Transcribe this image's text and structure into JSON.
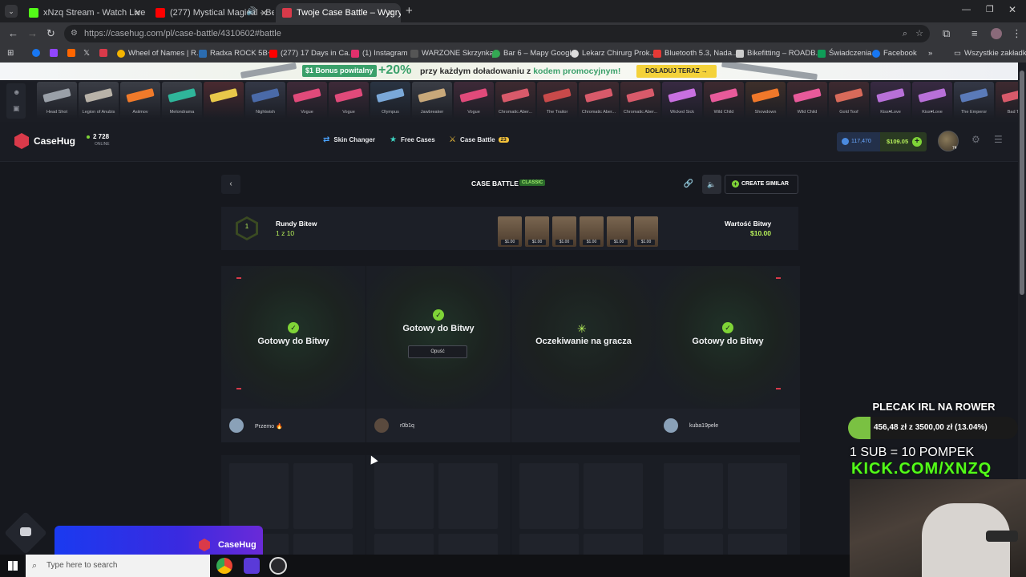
{
  "browser": {
    "tabs": [
      {
        "title": "xNzq Stream - Watch Live on K",
        "color": "#53fc18"
      },
      {
        "title": "(277) Mystical Magical - Be",
        "color": "#ff0000"
      },
      {
        "title": "Twoje Case Battle – Wygrywaj s",
        "color": "#d93a4a"
      }
    ],
    "url": "https://casehug.com/pl/case-battle/4310602#battle",
    "bookmarks": [
      {
        "label": "",
        "color": "#1877f2"
      },
      {
        "label": "",
        "color": "#9146ff"
      },
      {
        "label": "",
        "color": "#ff6600"
      },
      {
        "label": "",
        "color": "#000000"
      },
      {
        "label": "",
        "color": "#d93a4a"
      },
      {
        "label": "Wheel of Names | R...",
        "color": "#f4b400"
      },
      {
        "label": "Radxa ROCK 5B+",
        "color": "#2b6cb0"
      },
      {
        "label": "(277) 17 Days in Ca...",
        "color": "#ff0000"
      },
      {
        "label": "(1) Instagram",
        "color": "#e1306c"
      },
      {
        "label": "WARZONE Skrzynka...",
        "color": "#555555"
      },
      {
        "label": "Bar 6 – Mapy Google",
        "color": "#34a853"
      },
      {
        "label": "Lekarz Chirurg Prok...",
        "color": "#dddddd"
      },
      {
        "label": "Bluetooth 5.3, Nada...",
        "color": "#e53935"
      },
      {
        "label": "Bikefitting – ROADB...",
        "color": "#cccccc"
      },
      {
        "label": "Świadczenia",
        "color": "#0f9d58"
      },
      {
        "label": "Facebook",
        "color": "#1877f2"
      }
    ],
    "all_bookmarks": "Wszystkie zakładki"
  },
  "promo": {
    "bonus_badge": "$1 Bonus powitalny",
    "percent": "+20%",
    "text_before": "przy każdym doładowaniu z",
    "text_highlight": "kodem promocyjnym!",
    "button": "DOŁADUJ TERAZ"
  },
  "drops": [
    {
      "name": "Head Shot",
      "color": "#3b3e46",
      "gun": "#9aa0a8"
    },
    {
      "name": "Legion of Anubis",
      "color": "#3b3e46",
      "gun": "#b8b2a8"
    },
    {
      "name": "Asiimov",
      "color": "#3b3e46",
      "gun": "#f07a2a"
    },
    {
      "name": "Melondrama",
      "color": "#3b3e46",
      "gun": "#2fb59a"
    },
    {
      "name": "",
      "color": "#4a2a30",
      "gun": "#e8c84a"
    },
    {
      "name": "Nightwish",
      "color": "#343846",
      "gun": "#4a6aa8"
    },
    {
      "name": "Vogue",
      "color": "#3e2a38",
      "gun": "#e04a7a"
    },
    {
      "name": "Vogue",
      "color": "#3e2a38",
      "gun": "#e04a7a"
    },
    {
      "name": "Olympus",
      "color": "#2a3442",
      "gun": "#7aa8d8"
    },
    {
      "name": "Jawbreaker",
      "color": "#3b3e46",
      "gun": "#c8a87a"
    },
    {
      "name": "Vogue",
      "color": "#3e2a38",
      "gun": "#e04a7a"
    },
    {
      "name": "Chromatic Aber...",
      "color": "#3e2a30",
      "gun": "#d85a6a"
    },
    {
      "name": "The Traitor",
      "color": "#3e2a30",
      "gun": "#c84a4a"
    },
    {
      "name": "Chromatic Aber...",
      "color": "#3e2a30",
      "gun": "#d85a6a"
    },
    {
      "name": "Chromatic Aber...",
      "color": "#3e2a30",
      "gun": "#d85a6a"
    },
    {
      "name": "Wicked Sick",
      "color": "#382a42",
      "gun": "#c870e0"
    },
    {
      "name": "Wild Child",
      "color": "#3e2a30",
      "gun": "#e85a9a"
    },
    {
      "name": "Showdown",
      "color": "#3e2f2a",
      "gun": "#f0782a"
    },
    {
      "name": "Wild Child",
      "color": "#3e2a30",
      "gun": "#e85a9a"
    },
    {
      "name": "Gold Toof",
      "color": "#3e2a30",
      "gun": "#d86a5a"
    },
    {
      "name": "Kiss♥Love",
      "color": "#382a42",
      "gun": "#b870d8"
    },
    {
      "name": "Kiss♥Love",
      "color": "#382a42",
      "gun": "#b870d8"
    },
    {
      "name": "The Emperor",
      "color": "#343846",
      "gun": "#5a7ab8"
    },
    {
      "name": "Bad Trip",
      "color": "#3e2a30",
      "gun": "#d85a6a"
    }
  ],
  "header": {
    "logo": "CaseHug",
    "online_count": "2 728",
    "online_label": "ONLINE",
    "nav": {
      "skin_changer": "Skin Changer",
      "free_cases": "Free Cases",
      "case_battle": "Case Battle",
      "case_battle_count": "23"
    },
    "coins": "117,470",
    "balance": "$109.05",
    "avatar_level": "74"
  },
  "battle": {
    "title": "CASE BATTLE",
    "mode_badge": "CLASSIC",
    "create_similar": "CREATE SIMILAR",
    "round_number": "1",
    "rounds_label": "Rundy Bitew",
    "rounds_value": "1 z 10",
    "case_price": "$1.00",
    "case_count": 6,
    "value_label": "Wartość Bitwy",
    "value": "$10.00",
    "slots": [
      {
        "status": "Gotowy do Bitwy",
        "player": "Przemo 🔥",
        "state": "ready"
      },
      {
        "status": "Gotowy do Bitwy",
        "player": "r0b1q",
        "state": "ready",
        "leave_button": "Opuść"
      },
      {
        "status": "Oczekiwanie na gracza",
        "player": "",
        "state": "waiting"
      },
      {
        "status": "Gotowy do Bitwy",
        "player": "kuba19pele",
        "state": "ready"
      }
    ]
  },
  "chat_widget": {
    "brand": "CaseHug"
  },
  "taskbar": {
    "search_placeholder": "Type here to search"
  },
  "stream_overlay": {
    "goal_title": "PLECAK IRL NA ROWER",
    "goal_text": "456,48 zł z 3500,00 zł (13.04%)",
    "goal_percent": 13.04,
    "sub_text": "1 SUB = 10 POMPEK",
    "kick_text": "KICK.COM/XNZQ"
  }
}
